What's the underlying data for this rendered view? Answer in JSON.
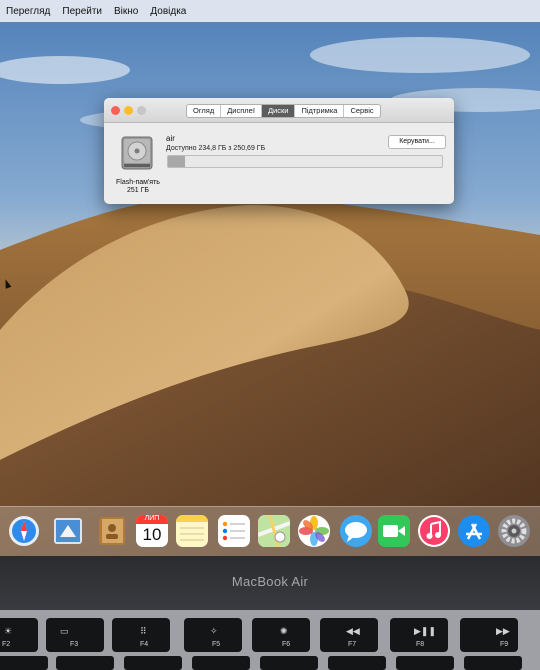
{
  "menubar": {
    "items": [
      "Перегляд",
      "Перейти",
      "Вікно",
      "Довідка"
    ]
  },
  "window": {
    "tabs": [
      "Огляд",
      "Дисплеї",
      "Диски",
      "Підтримка",
      "Сервіс"
    ],
    "active_tab": "Диски",
    "disk_type": "Flash-пам'ять",
    "disk_size": "251 ГБ",
    "volume_name": "air",
    "available_text": "Доступно 234,8 ГБ з 250,69 ГБ",
    "manage_button": "Керувати...",
    "used_fraction": 0.063
  },
  "calendar": {
    "month": "ЛИП",
    "day": "10"
  },
  "laptop": {
    "brand": "MacBook Air"
  },
  "keys": {
    "labels": [
      "F2",
      "F3",
      "F4",
      "F5",
      "F6",
      "F7",
      "F8",
      "F9"
    ]
  },
  "colors": {
    "menubar_bg": "#e8ecf2",
    "active_tab": "#5d5d5d",
    "close": "#fc5f57",
    "minimize": "#fdbb2e"
  }
}
